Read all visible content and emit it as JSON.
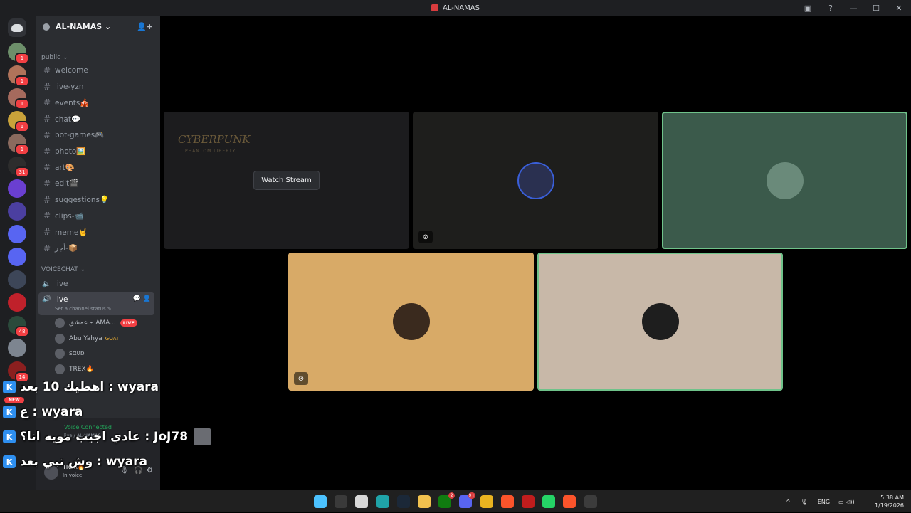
{
  "window": {
    "title": "AL-NAMAS"
  },
  "server": {
    "name": "AL-NAMAS ⌄"
  },
  "guilds": [
    {
      "name": "guild-1",
      "badge": "1",
      "color": "#6d8f6a"
    },
    {
      "name": "guild-2",
      "badge": "1",
      "color": "#b0735a"
    },
    {
      "name": "guild-3",
      "badge": "1",
      "color": "#a56a5d"
    },
    {
      "name": "guild-4",
      "badge": "1",
      "color": "#c9a23a"
    },
    {
      "name": "guild-5",
      "badge": "1",
      "color": "#8a6a5e"
    },
    {
      "name": "guild-6",
      "badge": "31",
      "color": "#2d2d2d"
    },
    {
      "name": "guild-7",
      "badge": "",
      "color": "#6a3fd1"
    },
    {
      "name": "guild-8",
      "badge": "",
      "color": "#4b3fa0"
    },
    {
      "name": "guild-9",
      "badge": "",
      "color": "#5865f2"
    },
    {
      "name": "guild-10",
      "badge": "",
      "color": "#5865f2"
    },
    {
      "name": "guild-11",
      "badge": "",
      "color": "#3d4658"
    },
    {
      "name": "guild-12",
      "badge": "",
      "color": "#c0212b"
    },
    {
      "name": "guild-13",
      "badge": "48",
      "color": "#2b4a3b"
    },
    {
      "name": "guild-14",
      "badge": "",
      "color": "#7d8590"
    },
    {
      "name": "guild-15",
      "badge": "14",
      "color": "#8b1f1f"
    }
  ],
  "categories": {
    "public": "public ⌄",
    "voicechat": "VOICECHAT ⌄"
  },
  "channels": [
    {
      "name": "welcome"
    },
    {
      "name": "live-yzn"
    },
    {
      "name": "events🎪"
    },
    {
      "name": "chat💬"
    },
    {
      "name": "bot-games🎮"
    },
    {
      "name": "photo🖼️"
    },
    {
      "name": "art🎨"
    },
    {
      "name": "edit🎬"
    },
    {
      "name": "suggestions💡"
    },
    {
      "name": "clips-📹"
    },
    {
      "name": "meme🤘"
    },
    {
      "name": "أجر-📦"
    }
  ],
  "voice_channels": {
    "live_1": "live",
    "live_2": "live",
    "status_placeholder": "Set a channel status ✎"
  },
  "voice_members": [
    {
      "name": "عمشق ⌁ AMA...",
      "badge": "LIVE"
    },
    {
      "name": "Abu Yahya",
      "badge": "GOAT"
    },
    {
      "name": "ѕαυɒ",
      "badge": ""
    },
    {
      "name": "TREX🔥",
      "badge": ""
    }
  ],
  "user_panel": {
    "voice_connected": "Voice Connected",
    "voice_sub": "live / AL-NAMAS",
    "username": "TREX🔥",
    "status": "In voice"
  },
  "stream": {
    "watch_label": "Watch Stream",
    "game_title": "CYBERPUNK",
    "game_sub": "PHANTOM LIBERTY"
  },
  "tiles": [
    {
      "name": "stream-tile",
      "bg": "#1c1c1e"
    },
    {
      "name": "user-tile-1",
      "bg": "#1e1e1c",
      "avatar": "#2a3050"
    },
    {
      "name": "user-tile-2",
      "bg": "#3b5a4b",
      "avatar": "#6a8a7a"
    },
    {
      "name": "user-tile-3",
      "bg": "#d8aa67",
      "avatar": "#3a2a1e"
    },
    {
      "name": "user-tile-4",
      "bg": "#c8b8a8",
      "avatar": "#1e1e1e"
    }
  ],
  "overlay_chat": [
    {
      "text": "اهطيك 10 بعد : wyara"
    },
    {
      "text": "ع : wyara"
    },
    {
      "text": "عادي اجيب مويه انا؟ : JoJ78"
    },
    {
      "text": "وش تبي بعد : wyara"
    }
  ],
  "new_badge": "NEW",
  "taskbar": {
    "apps": [
      {
        "name": "start-button",
        "color": "#4cc2ff",
        "badge": ""
      },
      {
        "name": "search-button",
        "color": "#3a3a3a",
        "badge": ""
      },
      {
        "name": "task-view-button",
        "color": "#d8d8d8",
        "badge": ""
      },
      {
        "name": "edge-app",
        "color": "#1fa3a8",
        "badge": ""
      },
      {
        "name": "steam-app",
        "color": "#1b2838",
        "badge": ""
      },
      {
        "name": "explorer-app",
        "color": "#f2c14e",
        "badge": ""
      },
      {
        "name": "xbox-app",
        "color": "#107c10",
        "badge": "2"
      },
      {
        "name": "discord-app",
        "color": "#5865f2",
        "badge": "9+"
      },
      {
        "name": "chrome-app",
        "color": "#e9b320",
        "badge": ""
      },
      {
        "name": "brave-app",
        "color": "#fb542b",
        "badge": ""
      },
      {
        "name": "medal-app",
        "color": "#c01d1d",
        "badge": ""
      },
      {
        "name": "whatsapp-app",
        "color": "#25d366",
        "badge": ""
      },
      {
        "name": "brave-app-2",
        "color": "#fb542b",
        "badge": ""
      },
      {
        "name": "obs-app",
        "color": "#3c3c3c",
        "badge": ""
      }
    ],
    "lang": "ENG",
    "time": "5:38 AM",
    "date": "1/19/2026"
  }
}
